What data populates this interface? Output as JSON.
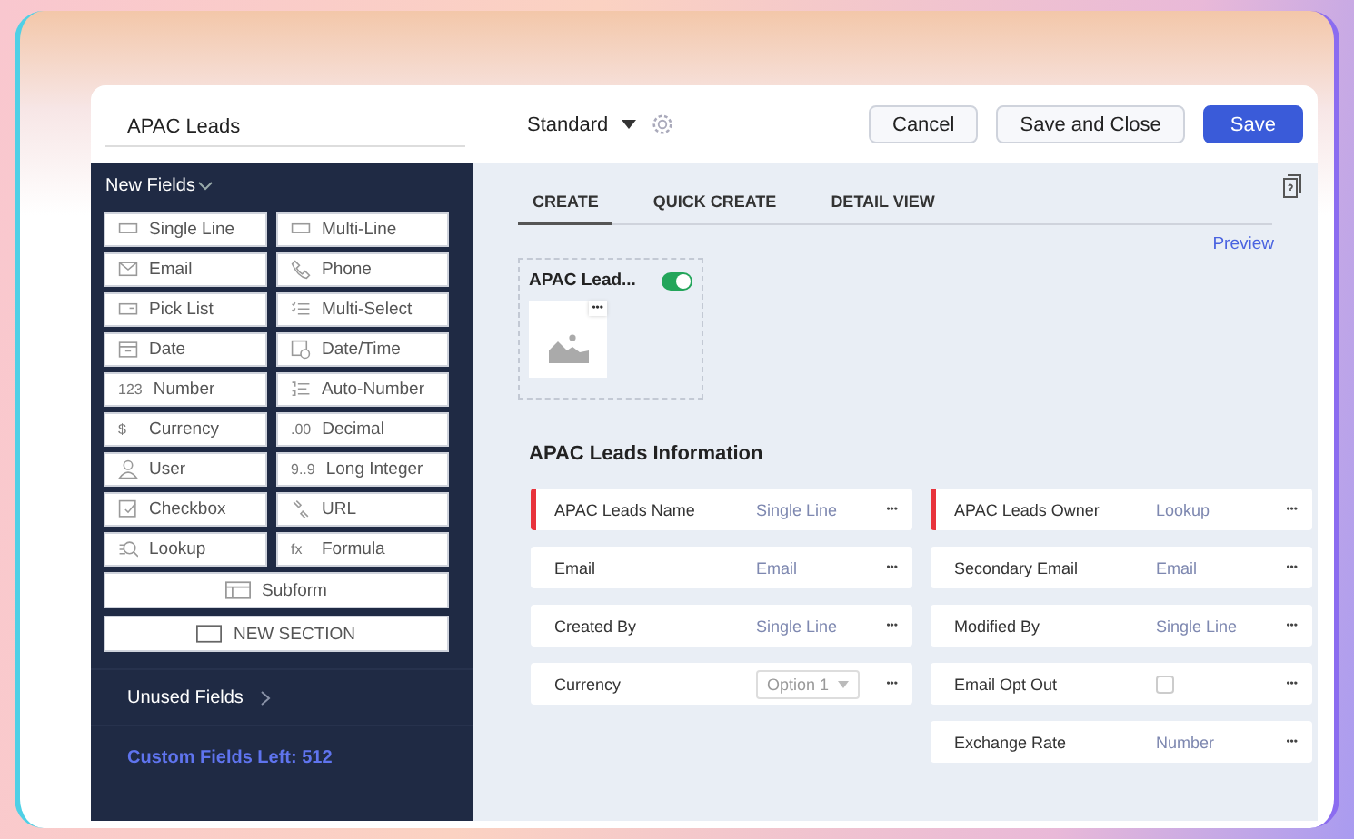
{
  "layout_name": "APAC Leads",
  "layout_switcher": {
    "label": "Standard"
  },
  "buttons": [
    {
      "label": "Cancel",
      "kind": "plain"
    },
    {
      "label": "Save and Close",
      "kind": "plain"
    },
    {
      "label": "Save",
      "kind": "primary"
    }
  ],
  "sidebar": {
    "heading": "New Fields",
    "field_types": [
      {
        "label": "Single Line"
      },
      {
        "label": "Multi-Line"
      },
      {
        "label": "Email"
      },
      {
        "label": "Phone"
      },
      {
        "label": "Pick List"
      },
      {
        "label": "Multi-Select"
      },
      {
        "label": "Date"
      },
      {
        "label": "Date/Time"
      },
      {
        "label": "Number",
        "glyph": "123"
      },
      {
        "label": "Auto-Number"
      },
      {
        "label": "Currency",
        "glyph": "$"
      },
      {
        "label": "Decimal",
        "glyph": ".00"
      },
      {
        "label": "User"
      },
      {
        "label": "Long Integer",
        "glyph": "9..9"
      },
      {
        "label": "Checkbox"
      },
      {
        "label": "URL"
      },
      {
        "label": "Lookup"
      },
      {
        "label": "Formula",
        "glyph": "fx"
      }
    ],
    "wide_buttons": [
      {
        "label": "Subform",
        "kind": "subform"
      },
      {
        "label": "NEW SECTION",
        "kind": "section"
      }
    ],
    "unused_fields": "Unused Fields",
    "custom_fields_left": "Custom Fields Left: 512"
  },
  "tabs": [
    {
      "label": "CREATE",
      "selected": true
    },
    {
      "label": "QUICK CREATE",
      "selected": false
    },
    {
      "label": "DETAIL VIEW",
      "selected": false
    }
  ],
  "preview_link": "Preview",
  "layout_card": {
    "title": "APAC Lead...",
    "on": true,
    "menu": "•••"
  },
  "section": {
    "title": "APAC Leads Information",
    "left_fields": [
      {
        "name": "APAC Leads Name",
        "kind": "text",
        "type": "Single Line",
        "required": true,
        "menu": "•••"
      },
      {
        "name": "Email",
        "kind": "text",
        "type": "Email",
        "required": false,
        "menu": "•••"
      },
      {
        "name": "Created By",
        "kind": "text",
        "type": "Single Line",
        "required": false,
        "menu": "•••"
      },
      {
        "name": "Currency",
        "kind": "select",
        "type": "Option 1",
        "required": false,
        "menu": "•••"
      }
    ],
    "right_fields": [
      {
        "name": "APAC Leads Owner",
        "kind": "text",
        "type": "Lookup",
        "required": true,
        "menu": "•••"
      },
      {
        "name": "Secondary Email",
        "kind": "text",
        "type": "Email",
        "required": false,
        "menu": "•••"
      },
      {
        "name": "Modified By",
        "kind": "text",
        "type": "Single Line",
        "required": false,
        "menu": "•••"
      },
      {
        "name": "Email Opt Out",
        "kind": "checkbox",
        "checked": false,
        "required": false,
        "menu": "•••"
      },
      {
        "name": "Exchange Rate",
        "kind": "text",
        "type": "Number",
        "required": false,
        "menu": "•••"
      }
    ]
  }
}
